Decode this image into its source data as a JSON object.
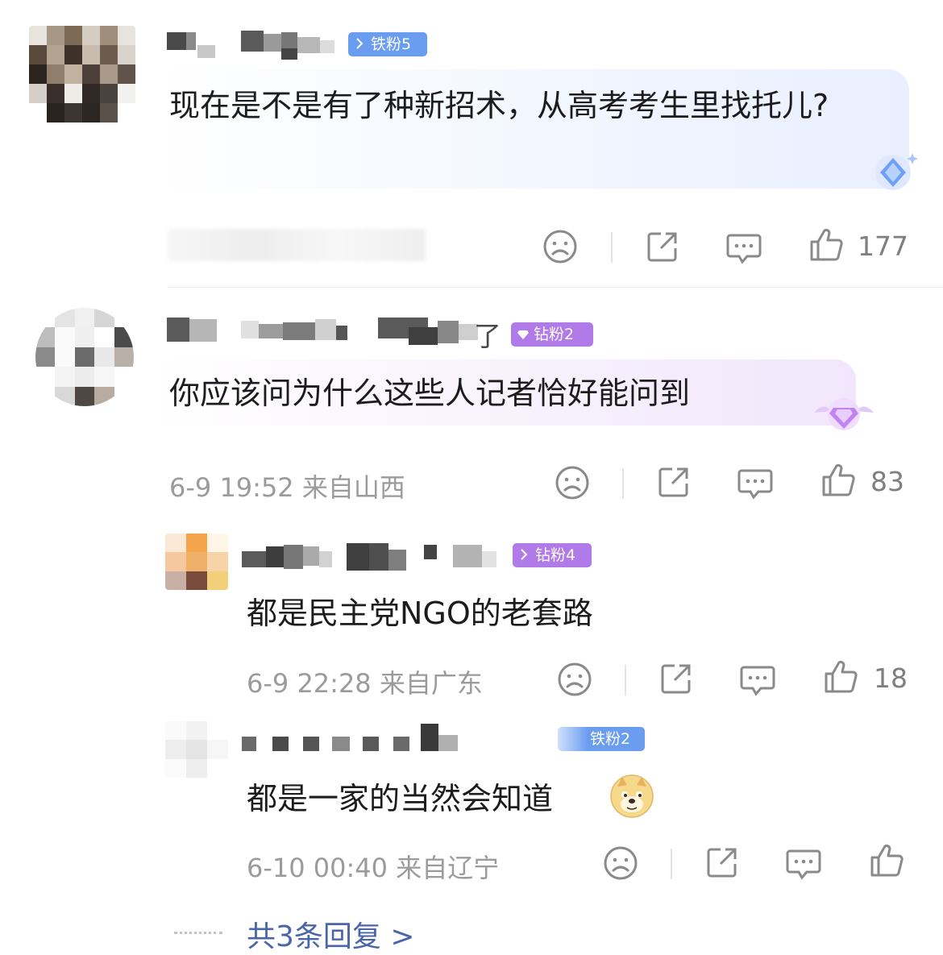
{
  "comments": [
    {
      "badge": "铁粉5",
      "badge_color": "#6a9cf0",
      "text": "现在是不是有了种新招术，从高考考生里找托儿?",
      "meta": "",
      "likes": "177"
    },
    {
      "name_suffix": "了",
      "badge": "钻粉2",
      "badge_color": "#b07ae8",
      "text": "你应该问为什么这些人记者恰好能问到",
      "meta": "6-9 19:52 来自山西",
      "likes": "83"
    }
  ],
  "replies": [
    {
      "badge": "钻粉4",
      "badge_color": "#b07ae8",
      "text": "都是民主党NGO的老套路",
      "meta": "6-9 22:28 来自广东",
      "likes": "18"
    },
    {
      "badge": "铁粉2",
      "badge_color": "#6a9cf0",
      "text": "都是一家的当然会知道",
      "emoji": "doge-emoji",
      "meta": "6-10 00:40 来自辽宁",
      "likes": ""
    }
  ],
  "more_replies": "共3条回复 >",
  "icons": [
    "sad-face-icon",
    "share-icon",
    "comment-icon",
    "like-icon"
  ]
}
